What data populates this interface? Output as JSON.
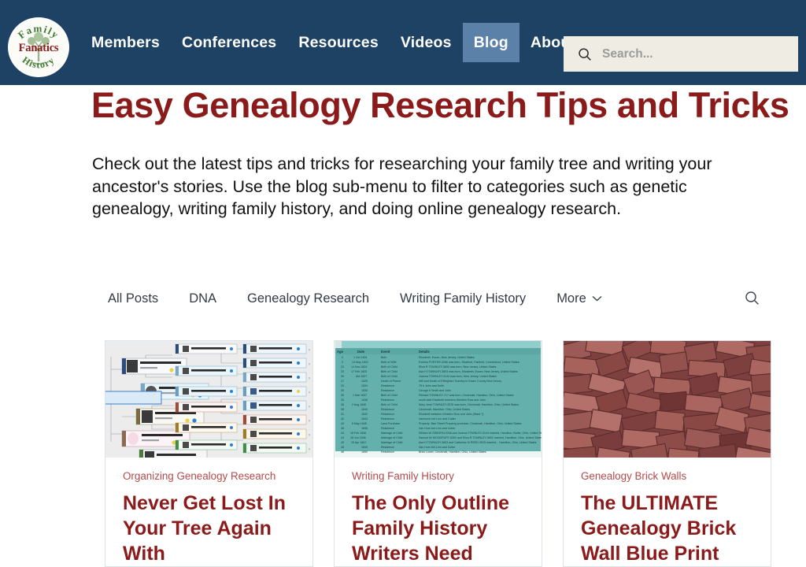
{
  "site": {
    "logo": {
      "top_text": "Family",
      "center_text": "Fanatics",
      "bottom_text": "History",
      "name": "Family History Fanatics"
    },
    "colors": {
      "nav_background": "#1d4263",
      "nav_active": "#5c81a9",
      "brand_red": "#8b1b1b",
      "category_red": "#b44a4a",
      "search_background": "#efece4",
      "logo_green": "#4a7a3a"
    }
  },
  "nav": {
    "items": [
      {
        "label": "Members",
        "active": false
      },
      {
        "label": "Conferences",
        "active": false
      },
      {
        "label": "Resources",
        "active": false
      },
      {
        "label": "Videos",
        "active": false
      },
      {
        "label": "Blog",
        "active": true
      },
      {
        "label": "About",
        "active": false
      }
    ]
  },
  "search": {
    "placeholder": "Search...",
    "value": "",
    "icon": "search-icon"
  },
  "header": {
    "title": "Easy Genealogy Research Tips and Tricks",
    "intro": "Check out the latest tips and tricks for researching your family tree and writing your ancestor's stories. Use the blog sub-menu to filter to categories such as genetic genealogy, writing family history, and doing online genealogy research."
  },
  "filters": {
    "tabs": [
      {
        "label": "All Posts"
      },
      {
        "label": "DNA"
      },
      {
        "label": "Genealogy Research"
      },
      {
        "label": "Writing Family History"
      },
      {
        "label": "More",
        "has_chevron": true
      }
    ],
    "search_icon": "search-icon"
  },
  "posts": [
    {
      "category": "Organizing Genealogy Research",
      "title": "Never Get Lost In Your Tree Again With",
      "thumb": {
        "kind": "pedigree-chart",
        "names": [
          "Robert Paul GEISZLER Jr-431",
          "Helen Grace ZUMSTEIN-701",
          "Penny Virginia BROWN-2",
          "Evaline Townley PEAK-23",
          "Robert Victor ZUMSTEIN-7",
          "Clementina COMFORT-720",
          "Sherman Lewis BROWN-26",
          "Lewis Sherman BROWN-3",
          "Emma Virginia TOWNSEND-9",
          "Harry Howard LONG-8",
          "Louise Eleanor LONG-4",
          "Evaline TOWNLEY-74",
          "Robert Walter ZUMSTEIN-980",
          "Adeline SNYDER-72",
          "Alonzo COMFORT-267",
          "Myra MARR-728",
          "Samuel Curtis BROWN-40",
          "Martha GORDON-4",
          "William James TOWNSEND-90",
          "Mary CLARBAUGH-75",
          "Dr William Lester LONG-80",
          "Sarah Angeline \"Angie\" RICE"
        ]
      }
    },
    {
      "category": "Writing Family History",
      "title": "The Only Outline Family History Writers Need",
      "thumb": {
        "kind": "timeline-table",
        "columns": [
          "Age",
          "Date",
          "Event",
          "Details"
        ],
        "rows": [
          {
            "age": "0",
            "date": "1 Oct 1801",
            "event": "Birth",
            "details": "Elizabeth, Essex, New Jersey, United States"
          },
          {
            "age": "0",
            "date": "13 May 1802",
            "event": "Birth of Wife",
            "details": "Evelina PORTER-3266 was born, Stratford, Fairfield, Connecticut, United States"
          },
          {
            "age": "23",
            "date": "14 Nov 1824",
            "event": "Birth of Child",
            "details": "Eliza R TOWNLEY-3692 was born, New Jersey, United States"
          },
          {
            "age": "23",
            "date": "17 Feb 1825",
            "event": "Birth of Child",
            "details": "Asa H TOWNLEY-3693 was born, Elizabeth, Essex, New Jersey, United States"
          },
          {
            "age": "26",
            "date": "Abt 1827",
            "event": "Birth of Child",
            "details": "Joanna TOWNLEY-3144 was born, New Jersey, United States"
          },
          {
            "age": "27",
            "date": "1828",
            "event": "Death of Parent",
            "details": "Will and Death of Effingham Townley in Essex County New Jersey"
          },
          {
            "age": "33",
            "date": "1834",
            "event": "Residence",
            "details": "78 b John and Keith"
          },
          {
            "age": "35",
            "date": "1836",
            "event": "Residence",
            "details": "George b Smith and John"
          },
          {
            "age": "35",
            "date": "1 Mar 1837",
            "event": "Birth of Child",
            "details": "Richard TOWNLEY-717 was born, Cincinnati, Hamilton, Ohio, United States"
          },
          {
            "age": "35",
            "date": "1838",
            "event": "Residence",
            "details": "south side Elizabeth between Western Row and John"
          },
          {
            "age": "38",
            "date": "2 Aug 1840",
            "event": "Birth of Child",
            "details": "Mary Jane TOWNLEY-3576 was born, Cincinnati, Hamilton, Ohio, United States"
          },
          {
            "age": "38",
            "date": "1840",
            "event": "Residence",
            "details": "Cincinnati, Hamilton, Ohio, United States"
          },
          {
            "age": "41",
            "date": "1842",
            "event": "Residence",
            "details": "Elizabeth between Western Row and John (Ward 7)"
          },
          {
            "age": "42",
            "date": "1843",
            "event": "Residence",
            "details": "Vanhorne bet Linn and Cutter"
          },
          {
            "age": "43",
            "date": "8 May 1845",
            "event": "Land Purchase",
            "details": "Property: Barr Street Property purchase, Cincinnati, Hamilton, Ohio, United States"
          },
          {
            "age": "45",
            "date": "1846",
            "event": "Residence",
            "details": "Van Horn bet Linn and Cutter"
          },
          {
            "age": "44",
            "date": "18 Feb 1846",
            "event": "Marriage of Child",
            "details": "William W OSBORN-9348 and Joanna TOWNLEY-3144 married, Hamilton, Butler, Ohio, United States"
          },
          {
            "age": "44",
            "date": "28 Jun 1846",
            "event": "Marriage of Child",
            "details": "Samuel W WOODRUFF-8392 and Eliza R TOWNLEY-3692 married, Hamilton, Ohio, United States"
          },
          {
            "age": "45",
            "date": "15 Apr 1847",
            "event": "Marriage of Child",
            "details": "Asa H TOWNLEY-3693 and Catherine M REED-3925 married, , Hamilton, Ohio, United States"
          },
          {
            "age": "48",
            "date": "1849",
            "event": "Residence",
            "details": "Van Horn bet Linn and Cutter"
          },
          {
            "age": "48",
            "date": "1850",
            "event": "Residence",
            "details": "Brick Lower, Cincinnati, Hamilton, Ohio, United States"
          }
        ]
      }
    },
    {
      "category": "Genealogy Brick Walls",
      "title": "The ULTIMATE Genealogy Brick Wall Blue Print",
      "thumb": {
        "kind": "brick-pile"
      }
    }
  ]
}
